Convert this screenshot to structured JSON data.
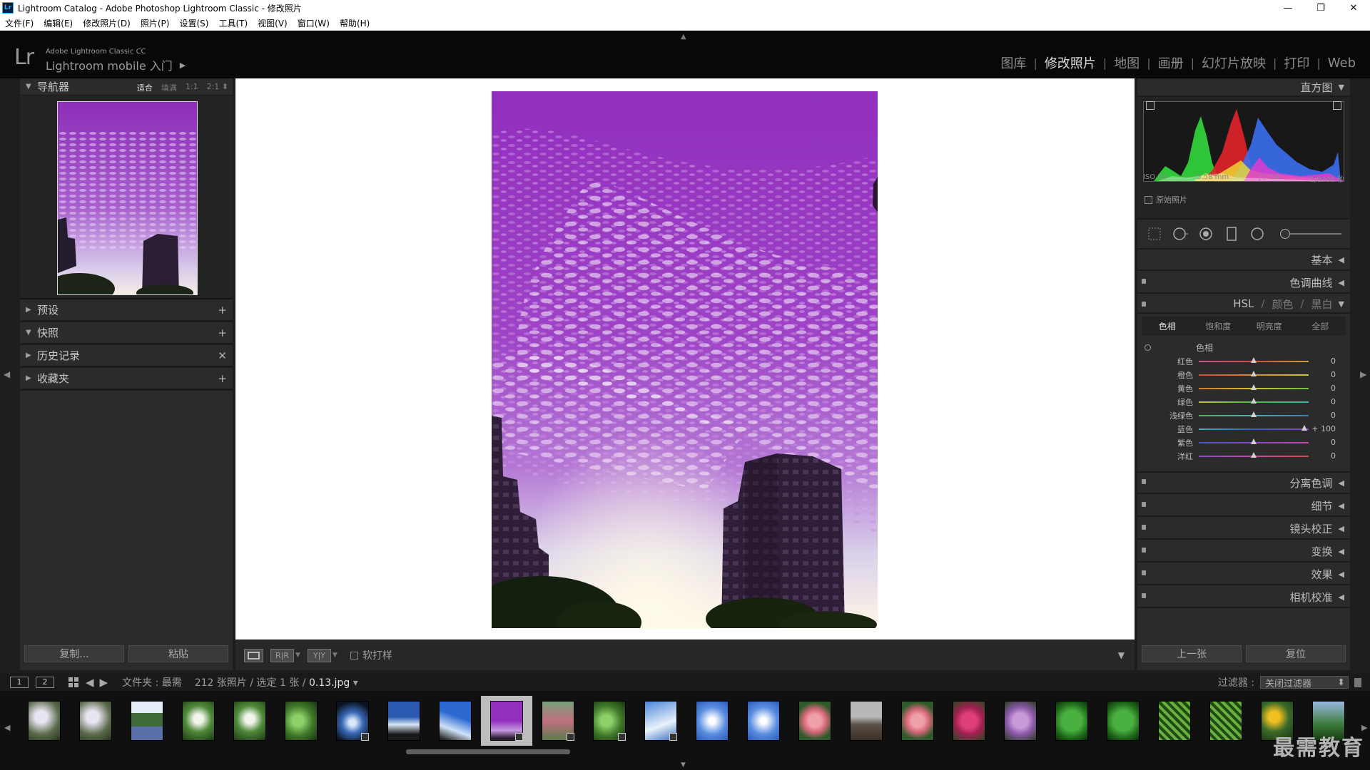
{
  "window": {
    "icon": "Lr",
    "title": "Lightroom Catalog - Adobe Photoshop Lightroom Classic - 修改照片",
    "controls": [
      "—",
      "❐",
      "✕"
    ]
  },
  "menu": [
    "文件(F)",
    "编辑(E)",
    "修改照片(D)",
    "照片(P)",
    "设置(S)",
    "工具(T)",
    "视图(V)",
    "窗口(W)",
    "帮助(H)"
  ],
  "identity": {
    "logo": "Lr",
    "product": "Adobe Lightroom Classic CC",
    "mobile": "Lightroom mobile 入门",
    "arrow": "▶"
  },
  "modules": [
    {
      "label": "图库",
      "active": false
    },
    {
      "label": "修改照片",
      "active": true
    },
    {
      "label": "地图",
      "active": false
    },
    {
      "label": "画册",
      "active": false
    },
    {
      "label": "幻灯片放映",
      "active": false
    },
    {
      "label": "打印",
      "active": false
    },
    {
      "label": "Web",
      "active": false
    }
  ],
  "left_panel": {
    "navigator": {
      "title": "导航器",
      "zoom": [
        "适合",
        "填满",
        "1:1",
        "2:1 ⬍"
      ],
      "zoom_active": 0
    },
    "sections": [
      {
        "title": "预设",
        "expanded": false,
        "action": "+"
      },
      {
        "title": "快照",
        "expanded": true,
        "action": "+"
      },
      {
        "title": "历史记录",
        "expanded": false,
        "action": "✕"
      },
      {
        "title": "收藏夹",
        "expanded": false,
        "action": "+"
      }
    ],
    "copy_button": "复制...",
    "paste_button": "粘贴"
  },
  "toolbar": {
    "soft_proof": "软打样",
    "ab_label_1": "R|R",
    "ab_label_2": "Y|Y"
  },
  "right_panel": {
    "histogram": {
      "title": "直方图",
      "iso": "ISO 50",
      "focal": "5.58 mm",
      "aperture": "ƒ / 1.8",
      "shutter": "1/8700 秒",
      "original_photo": "原始照片"
    },
    "basic": "基本",
    "tone_curve": "色调曲线",
    "hsl": {
      "title_hsl": "HSL",
      "title_color": "颜色",
      "title_bw": "黑白",
      "tabs": [
        "色相",
        "饱和度",
        "明亮度",
        "全部"
      ],
      "active_tab": 0,
      "group": "色相",
      "rows": [
        {
          "label": "红色",
          "value": "0",
          "level": 0,
          "gradient": "linear-gradient(90deg,#c9538e,#d24a3a,#c7a23c)"
        },
        {
          "label": "橙色",
          "value": "0",
          "level": 0,
          "gradient": "linear-gradient(90deg,#c9503a,#d58a35,#c9c23c)"
        },
        {
          "label": "黄色",
          "value": "0",
          "level": 0,
          "gradient": "linear-gradient(90deg,#cf7a35,#cfc13c,#6bbd46)"
        },
        {
          "label": "绿色",
          "value": "0",
          "level": 0,
          "gradient": "linear-gradient(90deg,#c4c23c,#4cb84c,#3ab5a5)"
        },
        {
          "label": "浅绿色",
          "value": "0",
          "level": 0,
          "gradient": "linear-gradient(90deg,#4ab85a,#3ab8b8,#3a78c9)"
        },
        {
          "label": "蓝色",
          "value": "+ 100",
          "level": 100,
          "gradient": "linear-gradient(90deg,#3ab5b5,#3a5ec9,#8a45c9)"
        },
        {
          "label": "紫色",
          "value": "0",
          "level": 0,
          "gradient": "linear-gradient(90deg,#4a58c9,#8a48c9,#c948b0)"
        },
        {
          "label": "洋红",
          "value": "0",
          "level": 0,
          "gradient": "linear-gradient(90deg,#8a48c9,#c948a8,#d24a4a)"
        }
      ]
    },
    "sections": [
      "分离色调",
      "细节",
      "镜头校正",
      "变换",
      "效果",
      "相机校准"
    ],
    "prev_button": "上一张",
    "reset_button": "复位"
  },
  "filmstrip_bar": {
    "screen_1": "1",
    "screen_2": "2",
    "folder": "文件夹 : 最需",
    "count": "212 张照片 / 选定 1 张 /",
    "filename": "0.13.jpg",
    "filter_label": "过滤器 :",
    "filter_value": "关闭过滤器"
  },
  "filmstrip": {
    "selected_index": 9,
    "thumbs": [
      {
        "kind": "flowers-white",
        "badge": false
      },
      {
        "kind": "flowers-white",
        "badge": false
      },
      {
        "kind": "pot-plant",
        "badge": false
      },
      {
        "kind": "flowers-green",
        "badge": false
      },
      {
        "kind": "flowers-green",
        "badge": false
      },
      {
        "kind": "leaves-green",
        "badge": false
      },
      {
        "kind": "sky-dark",
        "badge": true
      },
      {
        "kind": "sky-building",
        "badge": false
      },
      {
        "kind": "sky-blue",
        "badge": false
      },
      {
        "kind": "sky-purple",
        "badge": true
      },
      {
        "kind": "garden",
        "badge": true
      },
      {
        "kind": "leaves-green",
        "badge": true
      },
      {
        "kind": "sky-cloud",
        "badge": true
      },
      {
        "kind": "sky-bright",
        "badge": false
      },
      {
        "kind": "sky-bright",
        "badge": false
      },
      {
        "kind": "flowers-pink",
        "badge": false
      },
      {
        "kind": "city",
        "badge": false
      },
      {
        "kind": "flowers-pink",
        "badge": false
      },
      {
        "kind": "flowers-magenta",
        "badge": false
      },
      {
        "kind": "hydrangea",
        "badge": false
      },
      {
        "kind": "leaf-heart",
        "badge": false
      },
      {
        "kind": "leaf-heart",
        "badge": false
      },
      {
        "kind": "fern",
        "badge": false
      },
      {
        "kind": "fern",
        "badge": false
      },
      {
        "kind": "sunflowers",
        "badge": false
      },
      {
        "kind": "plant-blue",
        "badge": false
      }
    ]
  },
  "watermark": "最需教育",
  "colors": {
    "panel": "#2b2b2b",
    "accent_text": "#dcdcdc",
    "dim_text": "#8c8c8c",
    "photo_purple": "#9b3fc4"
  }
}
